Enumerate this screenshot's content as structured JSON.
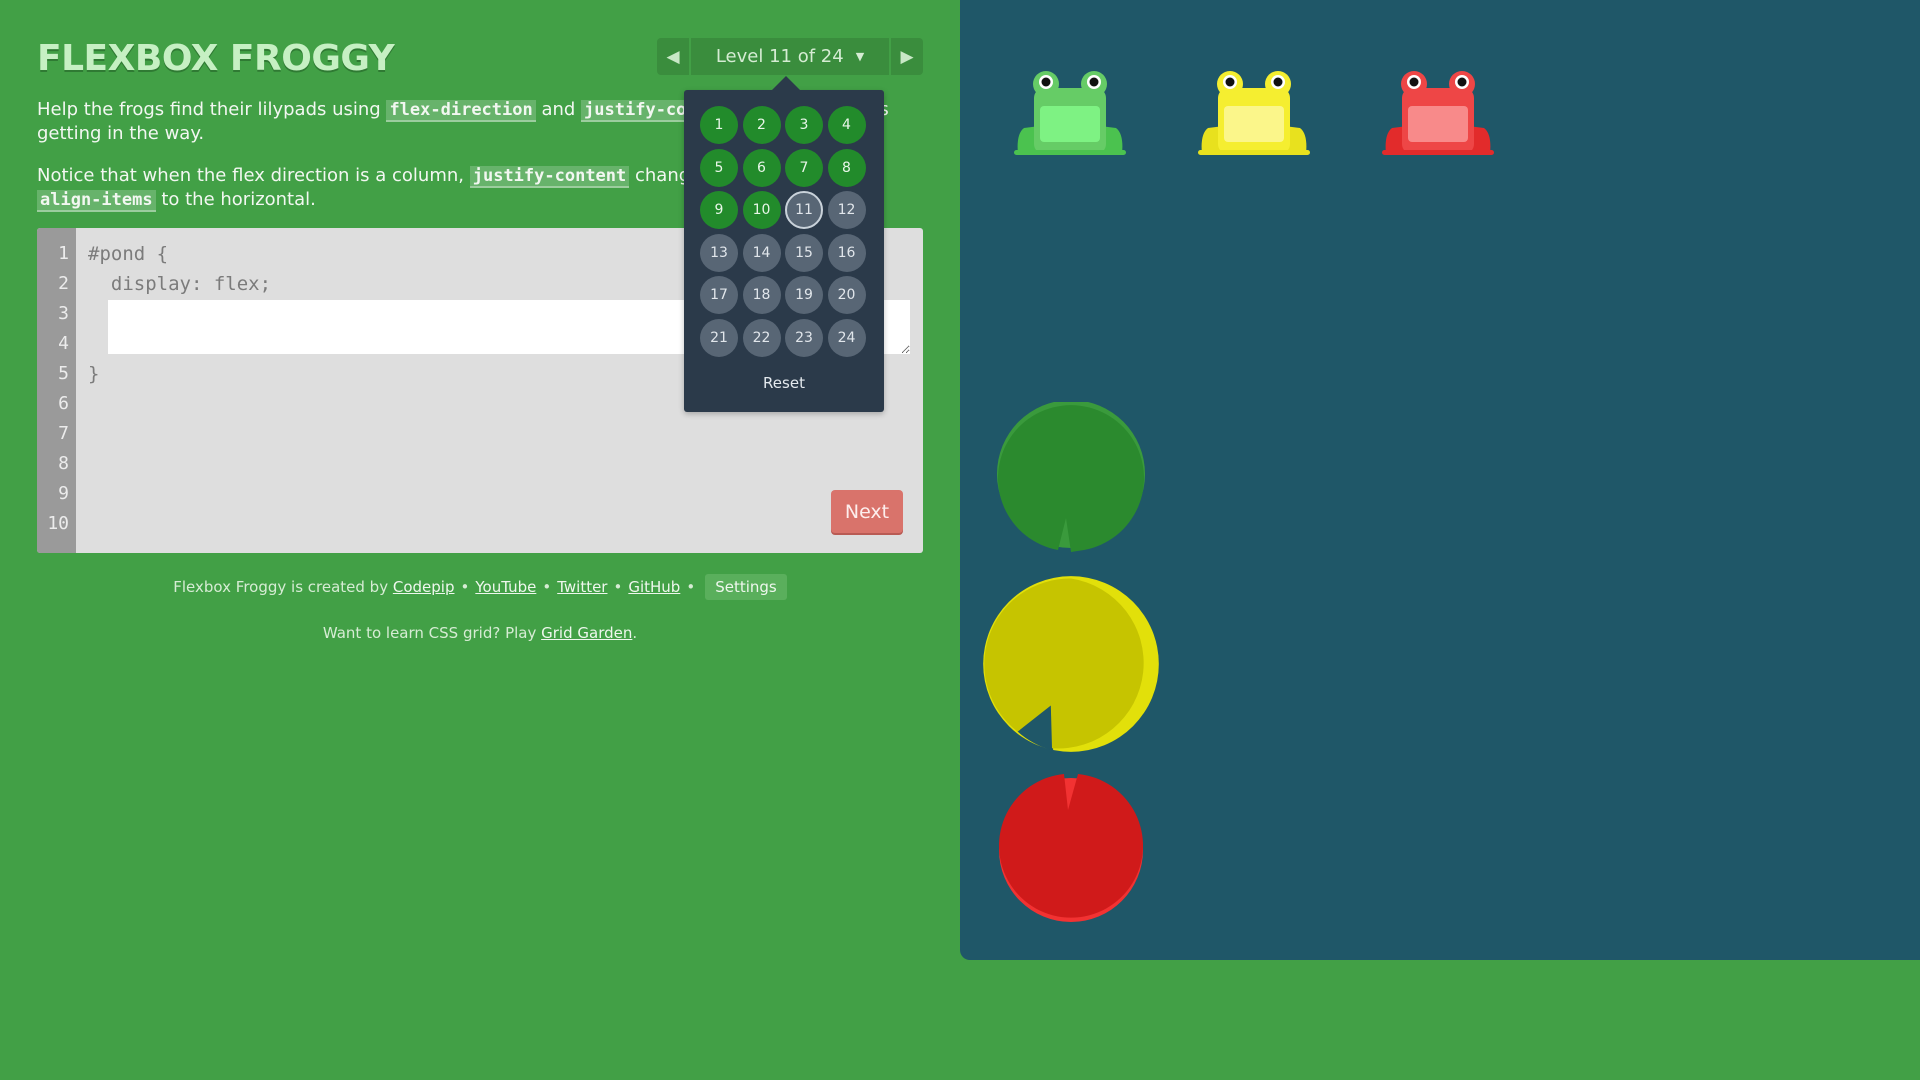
{
  "title": "FLEXBOX FROGGY",
  "level_nav": {
    "prev_icon": "◀",
    "label": "Level 11 of 24",
    "caret": "▼",
    "next_icon": "▶"
  },
  "instructions": {
    "p1": {
      "before": "Help the frogs find their lilypads using ",
      "code1": "flex-direction",
      "mid": " and ",
      "code2": "justify-content",
      "after": ". This frog keeps getting in the way."
    },
    "p2": {
      "before": "Notice that when the flex direction is a column, ",
      "code1": "justify-content",
      "mid": " changes to the vertical and ",
      "code2": "align-items",
      "after": " to the horizontal."
    }
  },
  "editor": {
    "line_numbers": [
      "1",
      "2",
      "3",
      "4",
      "5",
      "6",
      "7",
      "8",
      "9",
      "10"
    ],
    "line1": "#pond {",
    "line2": "  display: flex;",
    "line5": "}",
    "input_value": "",
    "next_label": "Next"
  },
  "footer": {
    "created_by": "Flexbox Froggy is created by ",
    "codepip": "Codepip",
    "youtube": "YouTube",
    "twitter": "Twitter",
    "github": "GitHub",
    "separator": "•",
    "settings": "Settings",
    "grid_prefix": "Want to learn CSS grid? Play ",
    "grid_link": "Grid Garden",
    "grid_suffix": "."
  },
  "level_dropdown": {
    "levels": [
      "1",
      "2",
      "3",
      "4",
      "5",
      "6",
      "7",
      "8",
      "9",
      "10",
      "11",
      "12",
      "13",
      "14",
      "15",
      "16",
      "17",
      "18",
      "19",
      "20",
      "21",
      "22",
      "23",
      "24"
    ],
    "solved": [
      1,
      2,
      3,
      4,
      5,
      6,
      7,
      8,
      9,
      10
    ],
    "current": 11,
    "reset_label": "Reset"
  },
  "frogs": [
    "green",
    "yellow",
    "red"
  ],
  "lilypads": [
    "green",
    "yellow",
    "red"
  ],
  "colors": {
    "background": "#42a046",
    "pond": "#1f5768",
    "next_button": "#d9736b",
    "dropdown": "#2b3a4a",
    "solved_level": "#228b2b",
    "unsolved_level": "#586675"
  }
}
